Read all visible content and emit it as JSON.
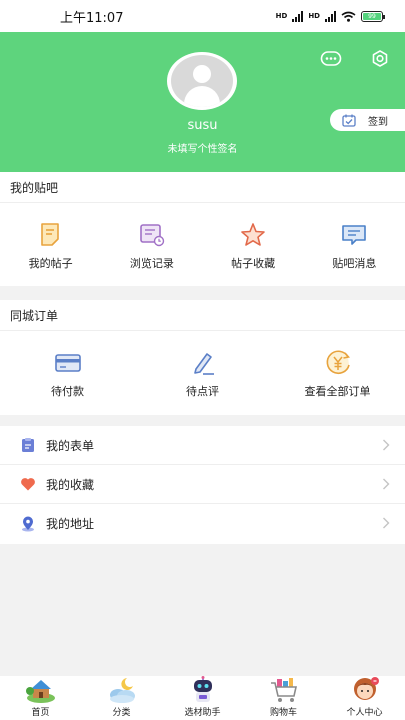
{
  "status": {
    "time": "上午11:07",
    "battery": "99"
  },
  "profile": {
    "username": "susu",
    "signature": "未填写个性签名",
    "checkin_label": "签到"
  },
  "my_tieba": {
    "title": "我的贴吧",
    "items": [
      {
        "label": "我的帖子",
        "icon": "post-icon"
      },
      {
        "label": "浏览记录",
        "icon": "history-icon"
      },
      {
        "label": "帖子收藏",
        "icon": "star-icon"
      },
      {
        "label": "贴吧消息",
        "icon": "message-icon"
      }
    ]
  },
  "orders": {
    "title": "同城订单",
    "items": [
      {
        "label": "待付款",
        "icon": "card-icon"
      },
      {
        "label": "待点评",
        "icon": "pen-icon"
      },
      {
        "label": "查看全部订单",
        "icon": "yen-icon"
      }
    ]
  },
  "menu": [
    {
      "label": "我的表单",
      "icon": "form-icon"
    },
    {
      "label": "我的收藏",
      "icon": "heart-icon"
    },
    {
      "label": "我的地址",
      "icon": "location-icon"
    }
  ],
  "tabs": [
    {
      "label": "首页",
      "icon": "home-icon"
    },
    {
      "label": "分类",
      "icon": "category-icon"
    },
    {
      "label": "选材助手",
      "icon": "robot-icon"
    },
    {
      "label": "购物车",
      "icon": "cart-icon"
    },
    {
      "label": "个人中心",
      "icon": "profile-icon"
    }
  ],
  "colors": {
    "brand_green": "#5ed47d",
    "icon_blue": "#5b7fc7",
    "icon_orange": "#e8a33d"
  }
}
